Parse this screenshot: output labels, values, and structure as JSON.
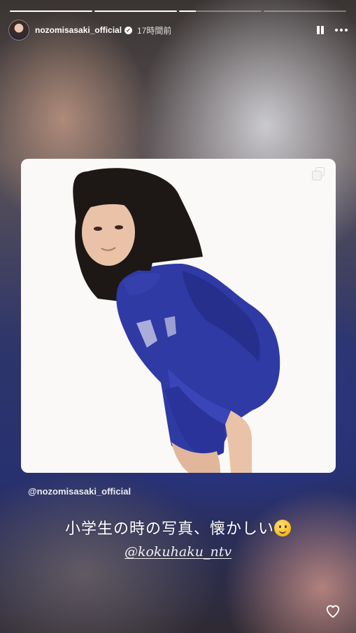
{
  "progress": {
    "segments": [
      1,
      1,
      0.2,
      0
    ]
  },
  "header": {
    "username": "nozomisasaki_official",
    "timestamp": "17時間前",
    "verified_glyph": "✓"
  },
  "icons": {
    "pause": "pause-icon",
    "more": "more-options-icon",
    "carousel": "carousel-icon",
    "like": "heart-icon"
  },
  "post": {
    "attribution": "@nozomisasaki_official"
  },
  "caption": {
    "text": "小学生の時の写真、懐かしい"
  },
  "mention": {
    "text": "@kokuhaku_ntv"
  },
  "colors": {
    "card_bg": "#faf9f7",
    "sweater": "#2f3aa5",
    "hair": "#1d1716",
    "skin": "#e9c2a8"
  }
}
